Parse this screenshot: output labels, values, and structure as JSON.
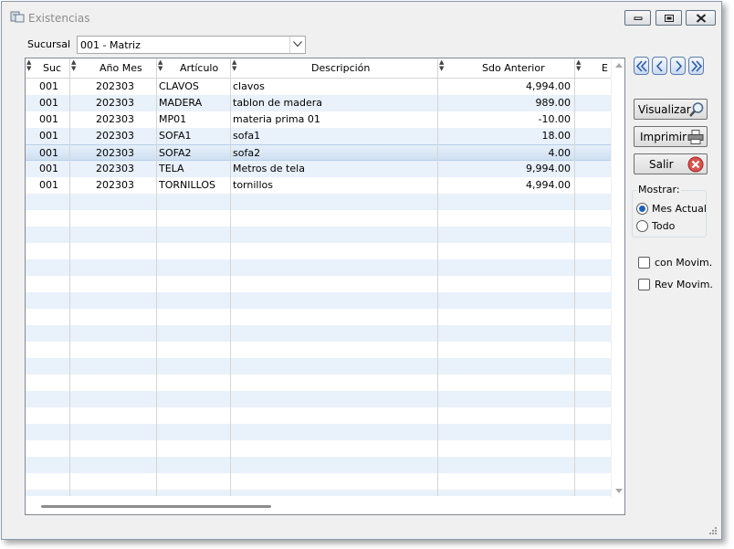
{
  "window": {
    "title": "Existencias"
  },
  "filter": {
    "label": "Sucursal",
    "value": "001 - Matriz"
  },
  "grid": {
    "columns": [
      "Suc",
      "Año Mes",
      "Artículo",
      "Descripción",
      "Sdo Anterior",
      "E"
    ],
    "rows": [
      [
        "001",
        "202303",
        "CLAVOS",
        "clavos",
        "4,994.00"
      ],
      [
        "001",
        "202303",
        "MADERA",
        "tablon de madera",
        "989.00"
      ],
      [
        "001",
        "202303",
        "MP01",
        "materia prima 01",
        "-10.00"
      ],
      [
        "001",
        "202303",
        "SOFA1",
        "sofa1",
        "18.00"
      ],
      [
        "001",
        "202303",
        "SOFA2",
        "sofa2",
        "4.00"
      ],
      [
        "001",
        "202303",
        "TELA",
        "Metros de tela",
        "9,994.00"
      ],
      [
        "001",
        "202303",
        "TORNILLOS",
        "tornillos",
        "4,994.00"
      ]
    ],
    "selected_row": 4
  },
  "actions": {
    "view": "Visualizar",
    "print": "Imprimir",
    "exit": "Salir"
  },
  "show": {
    "legend": "Mostrar:",
    "options": [
      "Mes Actual",
      "Todo"
    ],
    "selected": "Mes Actual"
  },
  "checks": {
    "con_movim": "con Movim.",
    "rev_movim": "Rev Movim."
  },
  "colors": {
    "row_alt": "#e9f1fb",
    "selected": "#cfe0f2",
    "exit_icon": "#d9534f"
  },
  "icons": [
    "app-icon",
    "minimize-icon",
    "restore-icon",
    "close-icon",
    "first-icon",
    "prev-icon",
    "next-icon",
    "last-icon",
    "magnifier-icon",
    "printer-icon",
    "exit-icon"
  ]
}
